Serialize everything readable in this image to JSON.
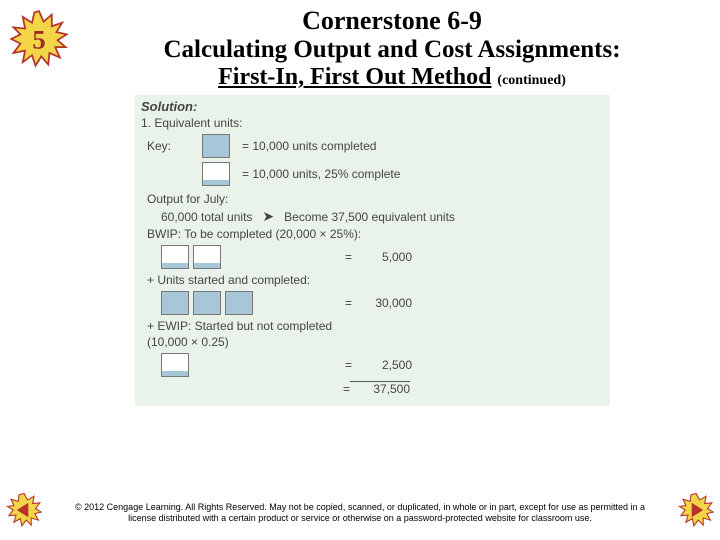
{
  "slide_number": "5",
  "title": {
    "line1": "Cornerstone 6-9",
    "line2": "Calculating Output and Cost Assignments:",
    "line3_underline": "First-In, First Out Method",
    "continued": "(continued)"
  },
  "solution": {
    "heading": "Solution:",
    "item1": "1.   Equivalent units:",
    "key_label": "Key:",
    "key_full": "=  10,000 units completed",
    "key_partial": "=  10,000 units, 25% complete",
    "output_label": "Output for July:",
    "output_total": "60,000 total units",
    "output_become": "Become 37,500 equivalent units",
    "bwip_label": "BWIP: To be completed (20,000 × 25%):",
    "bwip_value": "5,000",
    "started_label": "+  Units started and completed:",
    "started_value": "30,000",
    "ewip_label": "+  EWIP: Started but not completed",
    "ewip_calc": "(10,000 × 0.25)",
    "ewip_value": "2,500",
    "total_value": "37,500",
    "eq": "="
  },
  "footer": {
    "line1": "© 2012 Cengage Learning. All Rights Reserved. May not be copied, scanned, or duplicated, in whole or in part, except for use as permitted in a",
    "line2": "license distributed with a certain product or service or otherwise on a password-protected website for classroom use."
  }
}
